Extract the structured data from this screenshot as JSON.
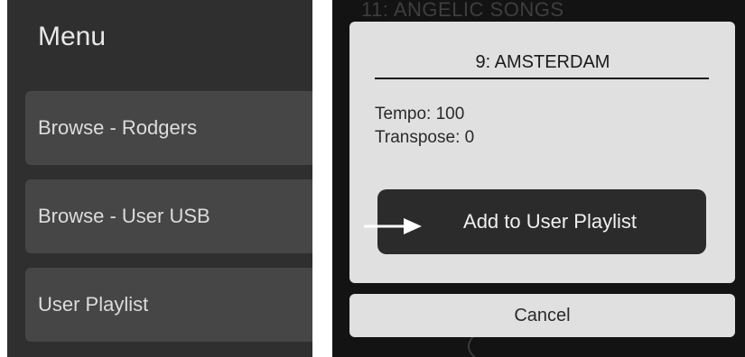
{
  "menu": {
    "title": "Menu",
    "items": [
      {
        "label": "Browse - Rodgers"
      },
      {
        "label": "Browse - User USB"
      },
      {
        "label": "User Playlist"
      }
    ]
  },
  "background": {
    "song_title": "11: ANGELIC SONGS"
  },
  "dialog": {
    "title": "9: AMSTERDAM",
    "tempo": "Tempo: 100",
    "transpose": "Transpose: 0",
    "add_button_label": "Add to User Playlist",
    "cancel_label": "Cancel"
  },
  "annotation": {
    "icon": "right-arrow-icon",
    "color": "#ffffff"
  },
  "colors": {
    "menu_background": "#2f2f2f",
    "menu_item": "#464646",
    "dialog_background": "#e0e0e0",
    "primary_button": "#2b2b2b"
  }
}
